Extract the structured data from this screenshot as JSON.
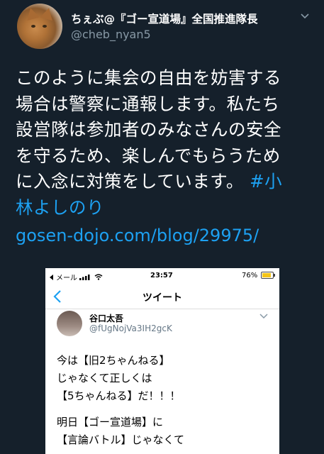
{
  "tweet": {
    "display_name": "ちぇぶ@『ゴー宣道場』全国推進隊長",
    "handle": "@cheb_nyan5",
    "body_lines": [
      "このように集会の自由を妨害する",
      "場合は警察に通報します。私たち",
      "設営隊は参加者のみなさんの安全",
      "を守るため、楽しんでもらうため",
      "に入念に対策をしています。"
    ],
    "hashtag_part1": "#小",
    "hashtag_part2": "林よしのり",
    "link": "gosen-dojo.com/blog/29975/"
  },
  "screenshot": {
    "status": {
      "carrier": "メール",
      "time": "23:57",
      "battery": "76%"
    },
    "nav_title": "ツイート",
    "quoted": {
      "name": "谷口太吾",
      "handle": "@fUgNojVa3IH2gcK",
      "lines": [
        "今は【旧2ちゃんねる】",
        "じゃなくて正しくは",
        "【5ちゃんねる】だ！！！"
      ],
      "lines2": [
        "明日【ゴー宣道場】に",
        "【言論バトル】じゃなくて"
      ]
    }
  },
  "icons": {
    "chevron": "chevron-down-icon",
    "back": "back-chevron-icon",
    "wifi": "wifi-icon",
    "battery": "battery-icon",
    "more": "more-chevron-icon"
  },
  "colors": {
    "background": "#15202b",
    "accent": "#1da1f2",
    "secondary_text": "#8899a6"
  }
}
